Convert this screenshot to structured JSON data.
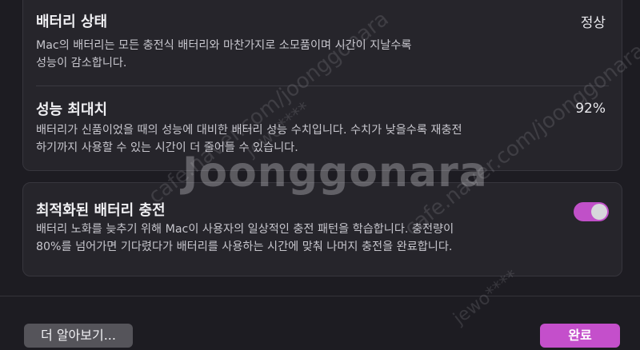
{
  "battery_health": {
    "title": "배터리 상태",
    "value": "정상",
    "description": "Mac의 배터리는 모든 충전식 배터리와 마찬가지로 소모품이며 시간이 지날수록\n성능이 감소합니다."
  },
  "max_capacity": {
    "title": "성능 최대치",
    "value": "92%",
    "description": "배터리가 신품이었을 때의 성능에 대비한 배터리 성능 수치입니다. 수치가 낮을수록 재충전\n하기까지 사용할 수 있는 시간이 더 줄어들 수 있습니다."
  },
  "optimized_charging": {
    "title": "최적화된 배터리 충전",
    "enabled": true,
    "description": "배터리 노화를 늦추기 위해 Mac이 사용자의 일상적인 충전 패턴을 학습합니다. 충전량이\n80%를 넘어가면 기다렸다가 배터리를 사용하는 시간에 맞춰 나머지 충전을 완료합니다."
  },
  "buttons": {
    "learn_more": "더 알아보기...",
    "done": "완료"
  },
  "watermarks": {
    "brand": "Joonggonara",
    "url": "cafe.naver.com/joonggonara",
    "user": "jewo****"
  },
  "colors": {
    "background": "#1d1c22",
    "panel": "#26252b",
    "accent": "#c44fcb"
  }
}
